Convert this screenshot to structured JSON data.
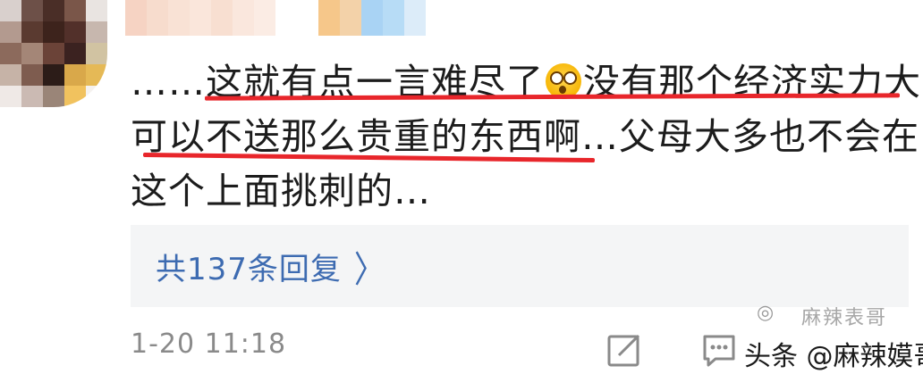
{
  "comment": {
    "line1_prefix": "……",
    "line1_highlight_a": "这就有点一言难尽了",
    "line1_highlight_b": "没有那个经济实力大",
    "line2_highlight": "可以不送那么贵重的东西啊…",
    "line2_rest": "父母大多也不会在",
    "line3": "这个上面挑刺的…",
    "emoji": "dizzy-face-emoji"
  },
  "replies": {
    "label": "共137条回复",
    "chevron": "〉"
  },
  "meta": {
    "timestamp": "1-20 11:18"
  },
  "watermark": {
    "caption": "头条 @麻辣嫫哥",
    "small_logo": "麻辣表哥"
  },
  "colors": {
    "underline": "#e8262b",
    "link": "#3d6bb1",
    "reply_bg": "#f4f5f6",
    "timestamp": "#8a8a8a"
  }
}
